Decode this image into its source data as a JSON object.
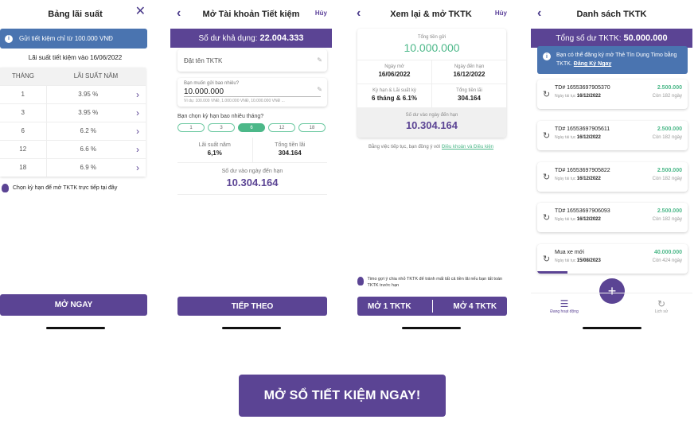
{
  "colors": {
    "primary": "#5b4494",
    "info": "#4a74b0",
    "success": "#4cb889"
  },
  "s1": {
    "title": "Bảng lãi suất",
    "close_icon": "close-icon",
    "notice": "Gửi tiết kiệm chỉ từ 100.000 VNĐ",
    "updated": "Lãi suất tiết kiệm vào 16/06/2022",
    "col_term": "THÁNG",
    "col_rate": "LÃI SUẤT NĂM",
    "rows": [
      {
        "term": "1",
        "rate": "3.95 %"
      },
      {
        "term": "3",
        "rate": "3.95 %"
      },
      {
        "term": "6",
        "rate": "6.2 %"
      },
      {
        "term": "12",
        "rate": "6.6 %"
      },
      {
        "term": "18",
        "rate": "6.9 %"
      }
    ],
    "hint": "Chọn kỳ hạn để mở TKTK trực tiếp tại đây",
    "button": "MỞ NGAY"
  },
  "s2": {
    "title": "Mở Tài khoản Tiết kiệm",
    "cancel": "Hủy",
    "balance_label": "Số dư khả dụng:",
    "balance_value": "22.004.333",
    "name_placeholder": "Đặt tên TKTK",
    "amount_label": "Bạn muốn gửi bao nhiêu?",
    "amount_value": "10.000.000",
    "amount_example": "Ví dụ: 100.000 VNĐ, 1.000.000 VNĐ, 10.000.000 VNĐ ...",
    "term_label": "Bạn chọn kỳ hạn bao nhiêu tháng?",
    "terms": [
      "1",
      "3",
      "6",
      "12",
      "18"
    ],
    "rate_label": "Lãi suất năm",
    "rate_value": "6,1%",
    "interest_label": "Tổng tiền lãi",
    "interest_value": "304.164",
    "maturity_label": "Số dư vào ngày đến hạn",
    "maturity_value": "10.304.164",
    "button": "TIẾP THEO"
  },
  "s3": {
    "title": "Xem lại & mở TKTK",
    "cancel": "Hủy",
    "total_label": "Tổng tiền gửi",
    "total_value": "10.000.000",
    "open_label": "Ngày mở",
    "open_value": "16/06/2022",
    "due_label": "Ngày đến hạn",
    "due_value": "16/12/2022",
    "term_label": "Kỳ hạn & Lãi suất kỳ",
    "term_value": "6 tháng & 6.1%",
    "interest_label": "Tổng tiền lãi",
    "interest_value": "304.164",
    "maturity_label": "Số dư vào ngày đến hạn",
    "maturity_value": "10.304.164",
    "agree_text": "Bằng việc tiếp tục, bạn đồng ý với",
    "agree_link": "Điều khoản và Điều kiện",
    "tip": "Timo gợi ý chia nhỏ TKTK để tránh mất tất cả tiền lãi nếu bạn tất toán TKTK trước hạn",
    "btn_left": "MỞ 1 TKTK",
    "btn_right": "MỞ 4 TKTK"
  },
  "s4": {
    "title": "Danh sách TKTK",
    "total_label": "Tổng số dư TKTK:",
    "total_value": "50.000.000",
    "notice": "Bạn có thể đăng ký mở Thẻ Tín Dụng Timo bằng TKTK.",
    "notice_link": "Đăng Ký Ngay",
    "accounts": [
      {
        "name": "TD# 16553697905370",
        "date_label": "Ngày tái tục",
        "date": "16/12/2022",
        "amount": "2.500.000",
        "remaining": "Còn 182 ngày",
        "progress": 0
      },
      {
        "name": "TD# 16553697905611",
        "date_label": "Ngày tái tục",
        "date": "16/12/2022",
        "amount": "2.500.000",
        "remaining": "Còn 182 ngày",
        "progress": 0
      },
      {
        "name": "TD# 16553697905822",
        "date_label": "Ngày tái tục",
        "date": "16/12/2022",
        "amount": "2.500.000",
        "remaining": "Còn 182 ngày",
        "progress": 0
      },
      {
        "name": "TD# 16553697906093",
        "date_label": "Ngày tái tục",
        "date": "16/12/2022",
        "amount": "2.500.000",
        "remaining": "Còn 182 ngày",
        "progress": 0
      },
      {
        "name": "Mua xe mới",
        "date_label": "Ngày tái tục",
        "date": "15/08/2023",
        "amount": "40.000.000",
        "remaining": "Còn 424 ngày",
        "progress": 0.2
      }
    ],
    "tab_active": "Đang hoạt động",
    "tab_history": "Lịch sử"
  },
  "cta": "MỞ SỔ TIẾT KIỆM NGAY!"
}
